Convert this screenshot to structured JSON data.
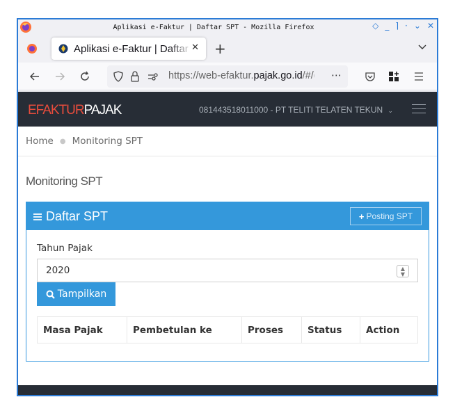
{
  "window": {
    "title": "Aplikasi e-Faktur | Daftar SPT - Mozilla Firefox",
    "accent_color": "#2b7bd6"
  },
  "browser": {
    "tab_title": "Aplikasi e-Faktur | Daftar SPT",
    "url_prefix": "https://web-efaktur.",
    "url_domain": "pajak.go.id",
    "url_suffix": "/#/(",
    "url_more": "⋯",
    "newtab_symbol": "+",
    "tab_close_symbol": "✕"
  },
  "app": {
    "brand_part1": "EFAKTUR",
    "brand_part2": "PAJAK",
    "brand_color": "#e74c3c",
    "user_info": "081443518011000 - PT TELITI TELATEN TEKUN",
    "user_dropdown_icon": "chevron-down-icon",
    "header_color": "#272d36"
  },
  "breadcrumb": {
    "items": [
      "Home",
      "Monitoring SPT"
    ]
  },
  "page": {
    "title": "Monitoring SPT"
  },
  "panel": {
    "title": "Daftar SPT",
    "posting_label": "Posting SPT",
    "color": "#3498db",
    "tahun_label": "Tahun Pajak",
    "tahun_value": "2020",
    "show_label": "Tampilkan",
    "table_headers": [
      "Masa Pajak",
      "Pembetulan ke",
      "Proses",
      "Status",
      "Action"
    ]
  }
}
